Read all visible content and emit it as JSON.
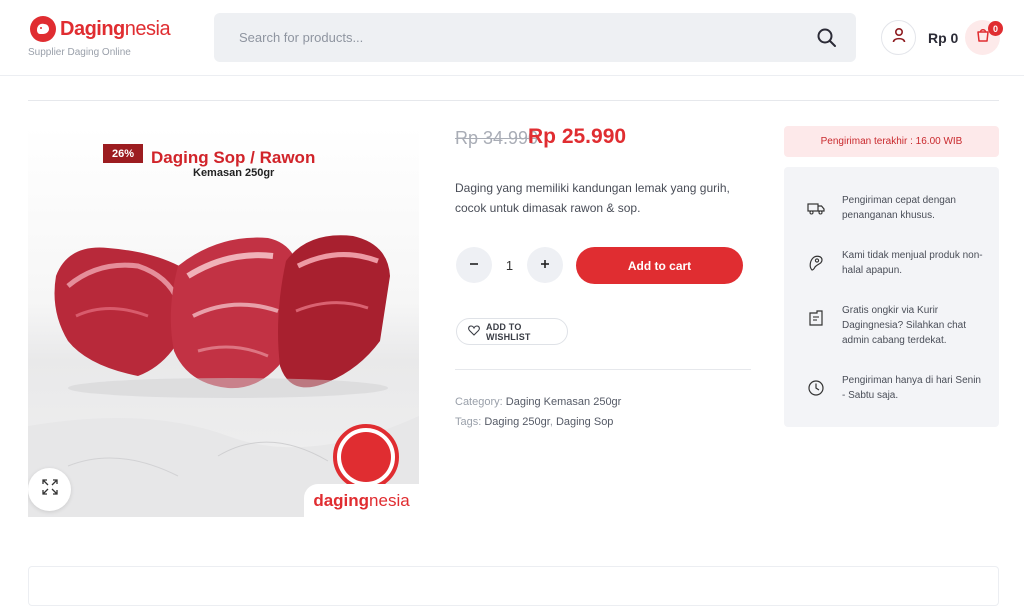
{
  "header": {
    "logo": {
      "brand_bold": "Daging",
      "brand_thin": "nesia",
      "tagline": "Supplier Daging Online"
    },
    "search": {
      "placeholder": "Search for products..."
    },
    "cart": {
      "total": "Rp 0",
      "count": "0"
    },
    "icons": [
      "search-icon",
      "user-icon",
      "shopping-bag-icon"
    ]
  },
  "product": {
    "image": {
      "badge": "26%",
      "title": "Daging Sop / Rawon",
      "subtitle": "Kemasan 250gr",
      "watermark_bold": "daging",
      "watermark_thin": "nesia"
    },
    "price_old": "Rp 34.990",
    "price_new": "Rp 25.990",
    "description": "Daging yang memiliki kandungan lemak yang gurih, cocok untuk dimasak rawon & sop.",
    "quantity": "1",
    "add_to_cart_label": "Add to cart",
    "wishlist_label": "ADD TO WISHLIST",
    "meta": {
      "category_label": "Category:",
      "category_value": "Daging Kemasan 250gr",
      "tags_label": "Tags:",
      "tags": [
        "Daging 250gr",
        "Daging Sop"
      ]
    }
  },
  "sidebar": {
    "notice": "Pengiriman terakhir : 16.00 WIB",
    "features": [
      {
        "icon": "truck-icon",
        "text": "Pengiriman cepat dengan penanganan khusus."
      },
      {
        "icon": "steak-icon",
        "text": "Kami tidak menjual produk non-halal apapun."
      },
      {
        "icon": "box-icon",
        "text": "Gratis ongkir via Kurir Dagingnesia? Silahkan chat admin cabang terdekat."
      },
      {
        "icon": "clock-icon",
        "text": "Pengiriman hanya di hari Senin - Sabtu saja."
      }
    ]
  },
  "colors": {
    "accent": "#e02d31",
    "muted": "#9aa0aa",
    "panel": "#f3f4f7"
  }
}
